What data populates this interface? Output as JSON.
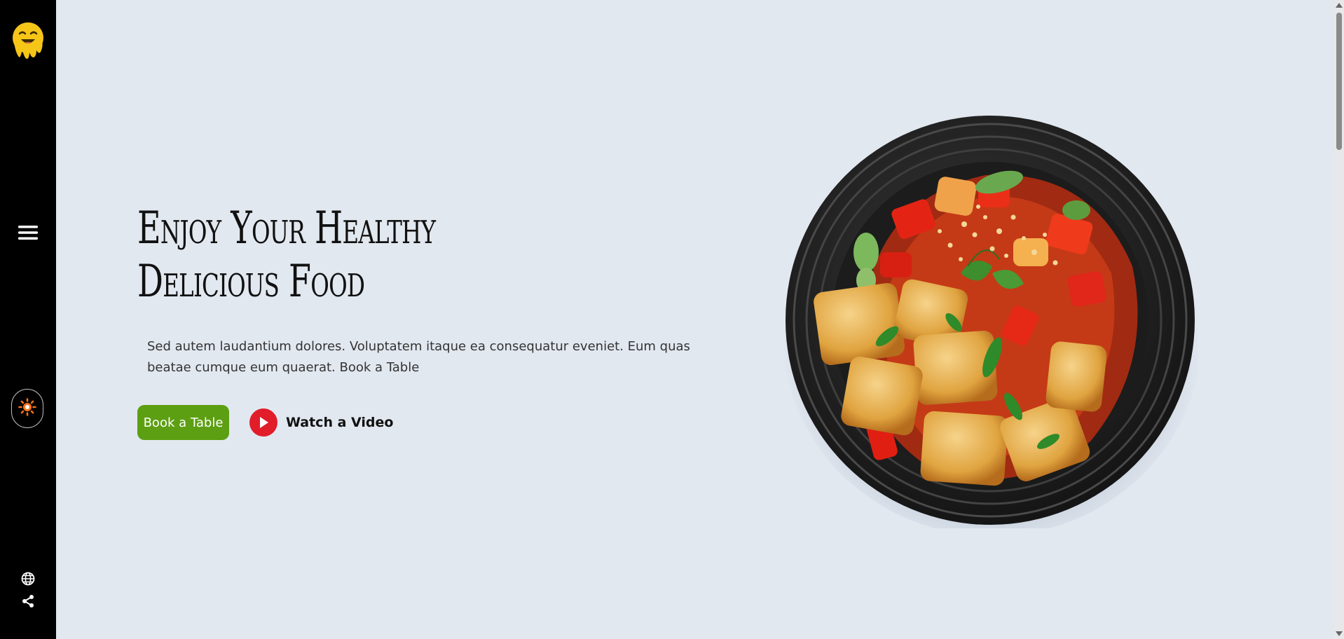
{
  "sidebar": {
    "logo_icon": "smiley-logo-icon",
    "menu_icon": "hamburger-menu-icon",
    "theme_icon": "sun-icon",
    "language_icon": "globe-icon",
    "share_icon": "share-icon"
  },
  "hero": {
    "title_line1": "Enjoy Your Healthy",
    "title_line2": "Delicious Food",
    "description": "Sed autem laudantium dolores. Voluptatem itaque ea consequatur eveniet. Eum quas beatae cumque eum quaerat. Book a Table",
    "book_button_label": "Book a Table",
    "video_button_label": "Watch a Video",
    "image_description": "food-plate-image"
  },
  "colors": {
    "background": "#e2e8f0",
    "sidebar": "#000000",
    "accent_green": "#5c9f12",
    "play_red": "#e11d2a",
    "logo_yellow": "#f5c518",
    "sun_orange": "#f97316"
  }
}
